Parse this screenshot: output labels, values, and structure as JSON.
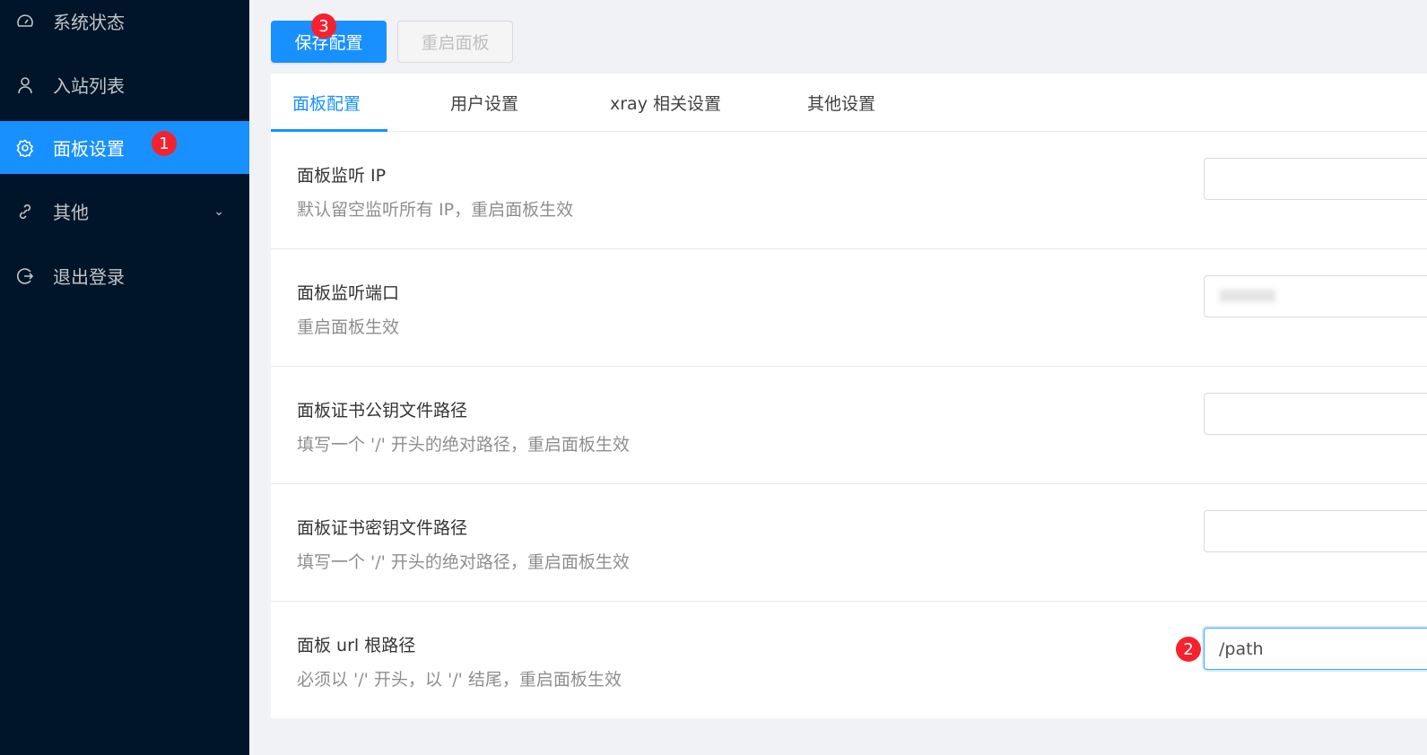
{
  "sidebar": {
    "items": [
      {
        "label": "系统状态",
        "icon": "dashboard-icon"
      },
      {
        "label": "入站列表",
        "icon": "user-icon"
      },
      {
        "label": "面板设置",
        "icon": "setting-icon",
        "selected": true
      },
      {
        "label": "其他",
        "icon": "link-icon",
        "expandable": true
      },
      {
        "label": "退出登录",
        "icon": "logout-icon"
      }
    ]
  },
  "toolbar": {
    "save_label": "保存配置",
    "restart_label": "重启面板"
  },
  "tabs": [
    {
      "label": "面板配置",
      "active": true
    },
    {
      "label": "用户设置"
    },
    {
      "label": "xray 相关设置"
    },
    {
      "label": "其他设置"
    }
  ],
  "settings": [
    {
      "title": "面板监听 IP",
      "desc": "默认留空监听所有 IP，重启面板生效",
      "value": ""
    },
    {
      "title": "面板监听端口",
      "desc": "重启面板生效",
      "value": ""
    },
    {
      "title": "面板证书公钥文件路径",
      "desc": "填写一个 '/' 开头的绝对路径，重启面板生效",
      "value": ""
    },
    {
      "title": "面板证书密钥文件路径",
      "desc": "填写一个 '/' 开头的绝对路径，重启面板生效",
      "value": ""
    },
    {
      "title": "面板 url 根路径",
      "desc": "必须以 '/' 开头，以 '/' 结尾，重启面板生效",
      "value": "/path"
    }
  ],
  "annotations": [
    "1",
    "2",
    "3"
  ],
  "colors": {
    "sidebar": "#001529",
    "accent": "#1890ff",
    "badge": "#f5222d"
  }
}
